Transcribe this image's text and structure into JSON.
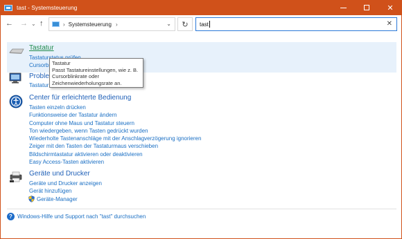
{
  "window": {
    "title": "tast - Systemsteuerung"
  },
  "nav": {
    "breadcrumb_item": "Systemsteuerung",
    "search_value": "tast"
  },
  "sections": {
    "keyboard": {
      "title": "Tastatur",
      "links": [
        "Tastaturstatus prüfen",
        "Cursorb"
      ]
    },
    "problems": {
      "title": "Proble",
      "links": [
        "Tastatur"
      ]
    },
    "ease": {
      "title": "Center für erleichterte Bedienung",
      "links": [
        "Tasten einzeln drücken",
        "Funktionsweise der Tastatur ändern",
        "Computer ohne Maus und Tastatur steuern",
        "Ton wiedergeben, wenn Tasten gedrückt wurden",
        "Wiederholte Tastenanschläge mit der Anschlagverzögerung ignorieren",
        "Zeiger mit den Tasten der Tastaturmaus verschieben",
        "Bildschirmtastatur aktivieren oder deaktivieren",
        "Easy Access-Tasten aktivieren"
      ]
    },
    "devices": {
      "title": "Geräte und Drucker",
      "links": [
        "Geräte und Drucker anzeigen",
        "Gerät hinzufügen",
        "Geräte-Manager"
      ]
    }
  },
  "tooltip": {
    "lines": [
      "Tastatur",
      "Passt Tastatureinstellungen, wie z. B.",
      "Cursorblinkrate oder",
      "Zeichenwiederholungsrate an."
    ]
  },
  "help": {
    "link": "Windows-Hilfe und Support nach \"tast\" durchsuchen"
  },
  "colors": {
    "titlebar": "#d0511a",
    "link": "#1a6fc4",
    "highlight": "#e7f1fb"
  }
}
